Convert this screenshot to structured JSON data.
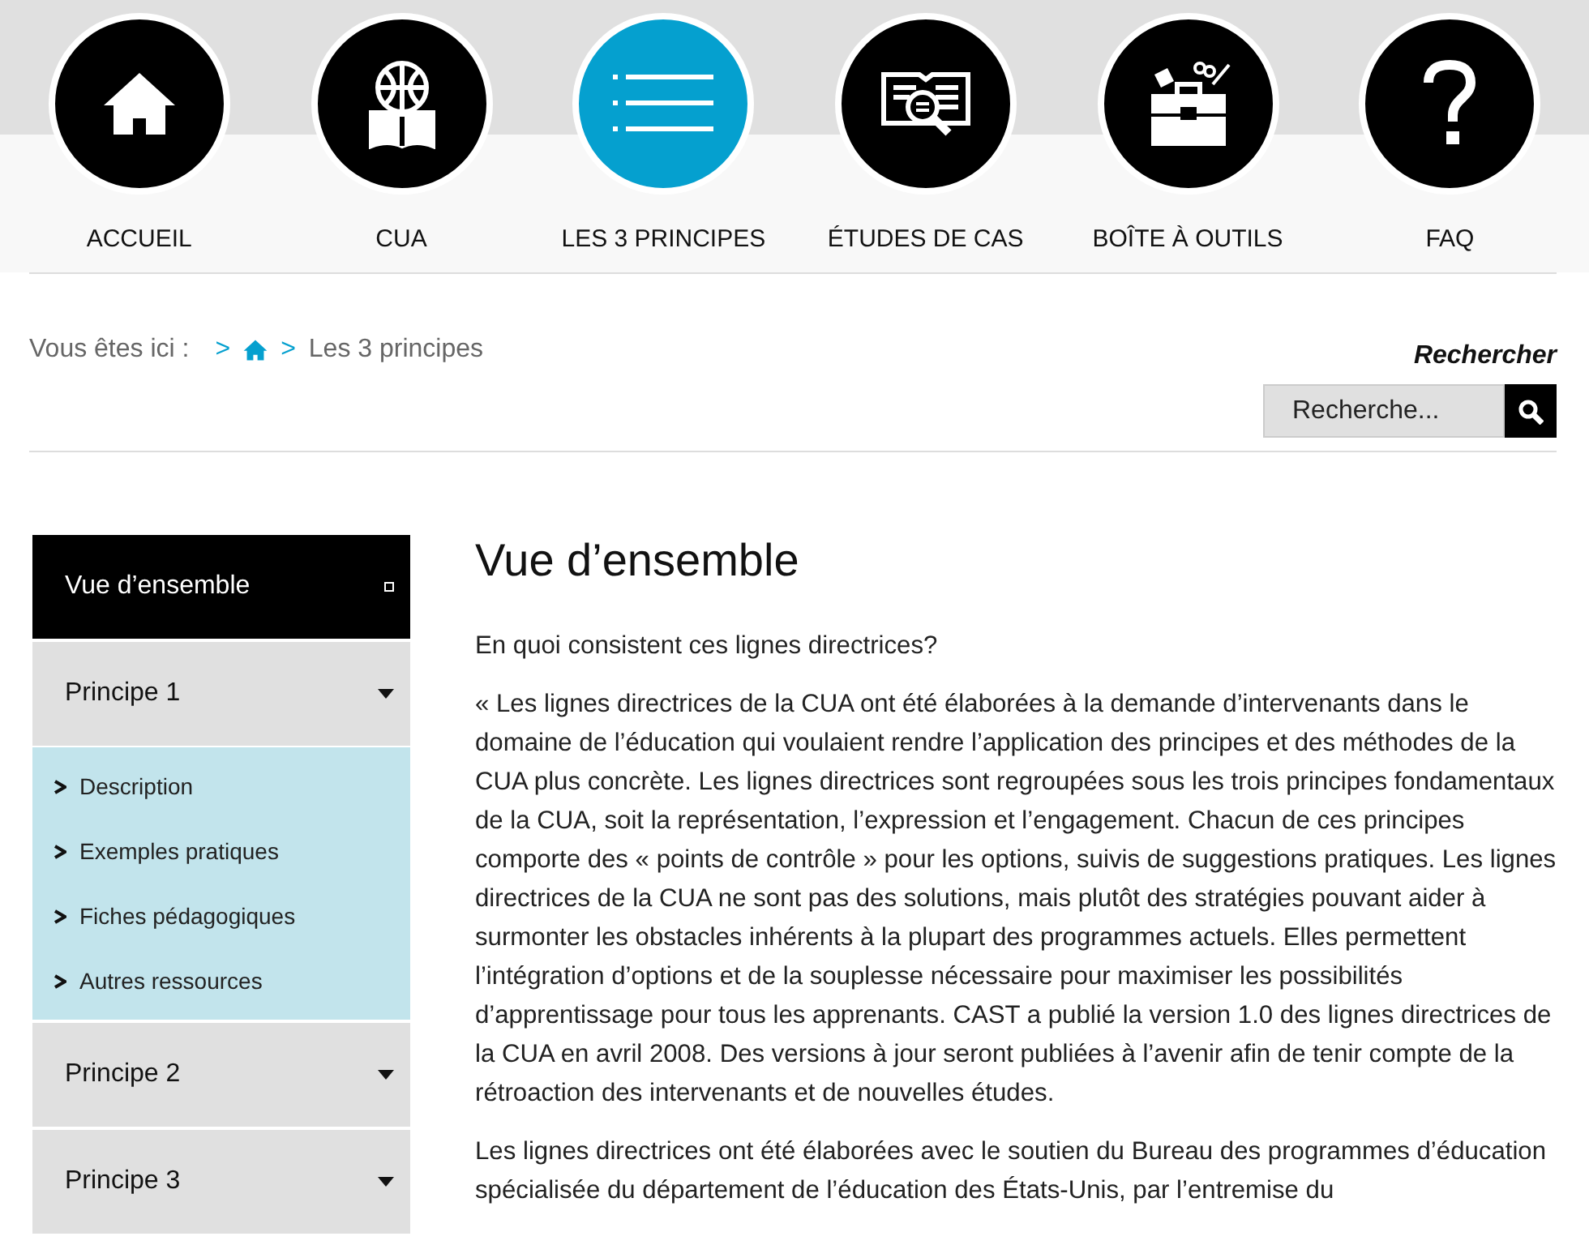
{
  "nav": [
    {
      "label": "ACCUEIL",
      "selected": false
    },
    {
      "label": "CUA",
      "selected": false
    },
    {
      "label": "LES 3 PRINCIPES",
      "selected": true
    },
    {
      "label": "ÉTUDES DE CAS",
      "selected": false
    },
    {
      "label": "BOÎTE À OUTILS",
      "selected": false
    },
    {
      "label": "FAQ",
      "selected": false
    }
  ],
  "breadcrumb": {
    "prefix": "Vous êtes ici :",
    "separators": [
      ">",
      ">"
    ],
    "current": "Les 3 principes"
  },
  "search": {
    "title": "Rechercher",
    "placeholder": "Recherche..."
  },
  "sidebar": [
    {
      "label": "Vue d’ensemble",
      "selected": true
    },
    {
      "label": "Principe 1",
      "selected": false,
      "children": [
        {
          "label": "Description"
        },
        {
          "label": "Exemples pratiques"
        },
        {
          "label": "Fiches pédagogiques"
        },
        {
          "label": "Autres ressources"
        }
      ]
    },
    {
      "label": "Principe 2",
      "selected": false
    },
    {
      "label": "Principe 3",
      "selected": false
    }
  ],
  "content": {
    "heading": "Vue d’ensemble",
    "question": "En quoi consistent ces lignes directrices?",
    "paragraphs": [
      "« Les lignes directrices de la CUA ont été élaborées à la demande d’intervenants dans le domaine de l’éducation qui voulaient rendre l’application des principes et des méthodes de la CUA plus concrète. Les lignes directrices sont regroupées sous les trois principes fondamentaux de la CUA, soit la représentation, l’expression et l’engagement. Chacun de ces principes comporte des « points de contrôle » pour les options, suivis de suggestions pratiques. Les lignes directrices de la CUA ne sont pas des solutions, mais plutôt des stratégies pouvant aider à surmonter les obstacles inhérents à la plupart des programmes actuels. Elles permettent l’intégration d’options et de la souplesse nécessaire pour maximiser les possibilités d’apprentissage pour tous les apprenants. CAST a publié la version 1.0 des lignes directrices de la CUA en avril 2008. Des versions à jour seront publiées à l’avenir afin de tenir compte de la rétroaction des intervenants et de nouvelles études.",
      "Les lignes directrices ont été élaborées avec le soutien du Bureau des programmes d’éducation spécialisée du département de l’éducation des États-Unis, par l’entremise du"
    ]
  }
}
